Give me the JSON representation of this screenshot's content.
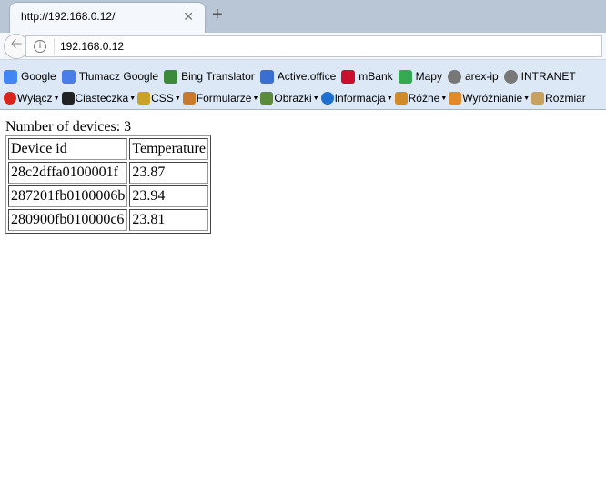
{
  "browser": {
    "tab_title": "http://192.168.0.12/",
    "url": "192.168.0.12"
  },
  "bookmarks": [
    {
      "label": "Google",
      "icon": "google-icon",
      "color": "#4285f4"
    },
    {
      "label": "Tłumacz Google",
      "icon": "translate-icon",
      "color": "#4a7de8"
    },
    {
      "label": "Bing Translator",
      "icon": "bing-translator-icon",
      "color": "#3a8a3a"
    },
    {
      "label": "Active.office",
      "icon": "active-office-icon",
      "color": "#3a6fcf"
    },
    {
      "label": "mBank",
      "icon": "mbank-icon",
      "color": "#c8102e"
    },
    {
      "label": "Mapy",
      "icon": "maps-icon",
      "color": "#34a853"
    },
    {
      "label": "arex-ip",
      "icon": "globe-icon",
      "color": "#777777"
    },
    {
      "label": "INTRANET",
      "icon": "globe-icon",
      "color": "#777777"
    }
  ],
  "toolbar": [
    {
      "label": "Wyłącz",
      "icon": "disable-icon",
      "color": "#d9251c"
    },
    {
      "label": "Ciasteczka",
      "icon": "cookies-icon",
      "color": "#222222"
    },
    {
      "label": "CSS",
      "icon": "css-wand-icon",
      "color": "#c9a227"
    },
    {
      "label": "Formularze",
      "icon": "forms-icon",
      "color": "#c87a2a"
    },
    {
      "label": "Obrazki",
      "icon": "images-icon",
      "color": "#5a8a3a"
    },
    {
      "label": "Informacja",
      "icon": "info-icon",
      "color": "#1e6fd0"
    },
    {
      "label": "Różne",
      "icon": "misc-icon",
      "color": "#d08a2a"
    },
    {
      "label": "Wyróżnianie",
      "icon": "pencil-icon",
      "color": "#e08a2a"
    },
    {
      "label": "Rozmiar",
      "icon": "ruler-icon",
      "color": "#c8a060"
    }
  ],
  "page": {
    "count_text": "Number of devices: 3",
    "headers": [
      "Device id",
      "Temperature"
    ],
    "rows": [
      [
        "28c2dffa0100001f",
        "23.87"
      ],
      [
        "287201fb0100006b",
        "23.94"
      ],
      [
        "280900fb010000c6",
        "23.81"
      ]
    ]
  }
}
